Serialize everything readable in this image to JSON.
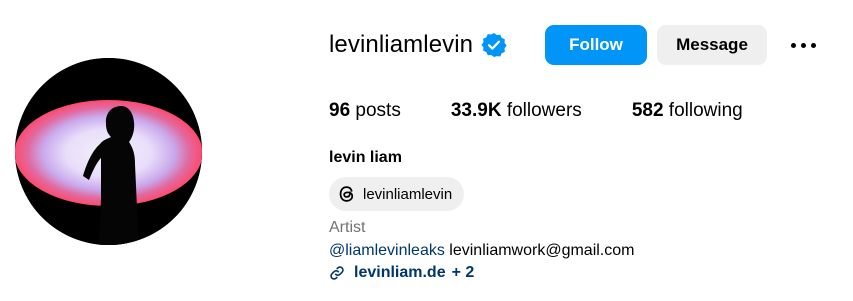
{
  "profile": {
    "username": "levinliamlevin",
    "full_name": "levin liam",
    "verified_icon": "verified-badge-icon",
    "accent_color": "#0095f6"
  },
  "actions": {
    "follow_label": "Follow",
    "message_label": "Message",
    "more_icon": "more-options-icon"
  },
  "stats": {
    "posts_count": "96",
    "posts_label": "posts",
    "followers_count": "33.9K",
    "followers_label": "followers",
    "following_count": "582",
    "following_label": "following"
  },
  "threads": {
    "handle": "levinliamlevin",
    "icon": "threads-icon"
  },
  "bio": {
    "category": "Artist",
    "mention": "@liamlevinleaks",
    "email": "levinliamwork@gmail.com",
    "link_text": "levinliam.de",
    "link_more": "+ 2",
    "link_icon": "link-icon"
  }
}
